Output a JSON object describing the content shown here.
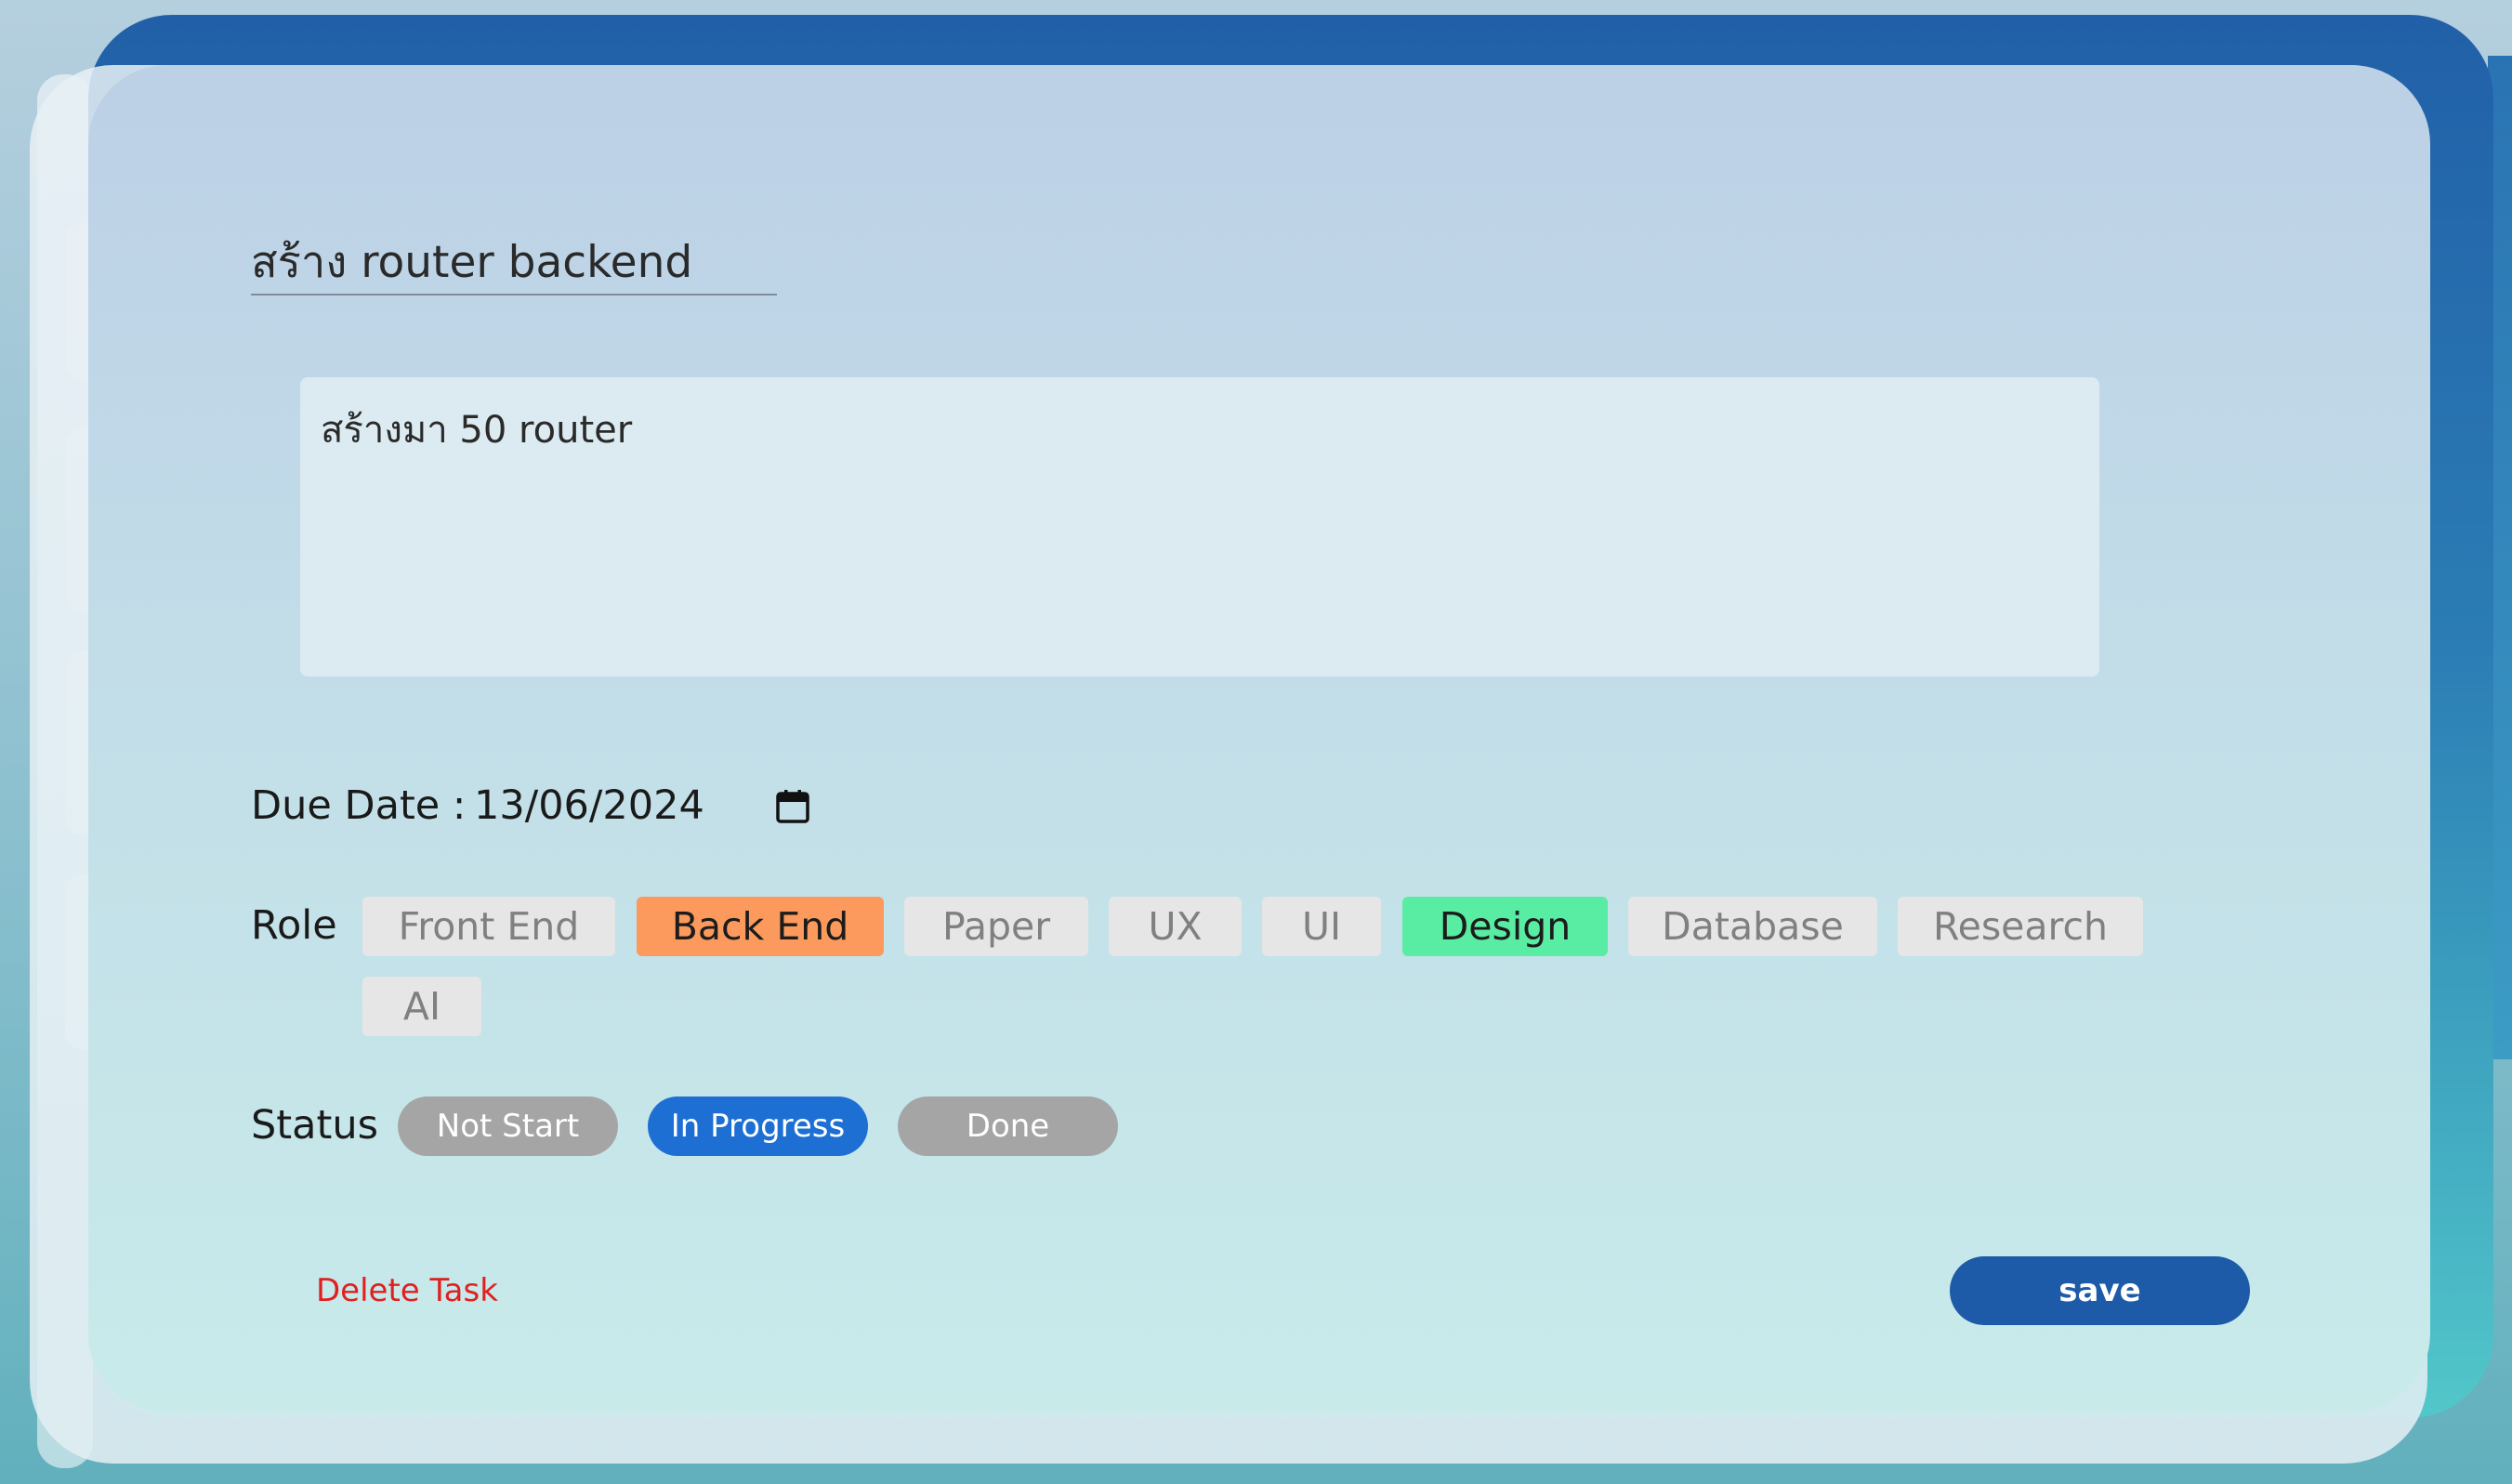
{
  "task": {
    "title": "สร้าง router backend",
    "description": "สร้างมา 50 router"
  },
  "due_date": {
    "label": "Due Date :",
    "value": "13/06/2024",
    "icon": "calendar-icon"
  },
  "role": {
    "label": "Role",
    "options": [
      {
        "label": "Front End",
        "selected": false
      },
      {
        "label": "Back End",
        "selected": true,
        "color": "#fb9a5c"
      },
      {
        "label": "Paper",
        "selected": false
      },
      {
        "label": "UX",
        "selected": false
      },
      {
        "label": "UI",
        "selected": false
      },
      {
        "label": "Design",
        "selected": true,
        "color": "#58eda2"
      },
      {
        "label": "Database",
        "selected": false
      },
      {
        "label": "Research",
        "selected": false
      },
      {
        "label": "AI",
        "selected": false
      }
    ]
  },
  "status": {
    "label": "Status",
    "options": [
      {
        "label": "Not Start",
        "selected": false
      },
      {
        "label": "In Progress",
        "selected": true,
        "color": "#1e6fd3"
      },
      {
        "label": "Done",
        "selected": false
      }
    ]
  },
  "actions": {
    "delete_label": "Delete Task",
    "save_label": "save"
  },
  "colors": {
    "header": "#2160a8",
    "save_button": "#1d5aa8",
    "delete_text": "#e02020",
    "unselected_chip": "#e6e6e6",
    "unselected_status": "#a5a5a5"
  }
}
